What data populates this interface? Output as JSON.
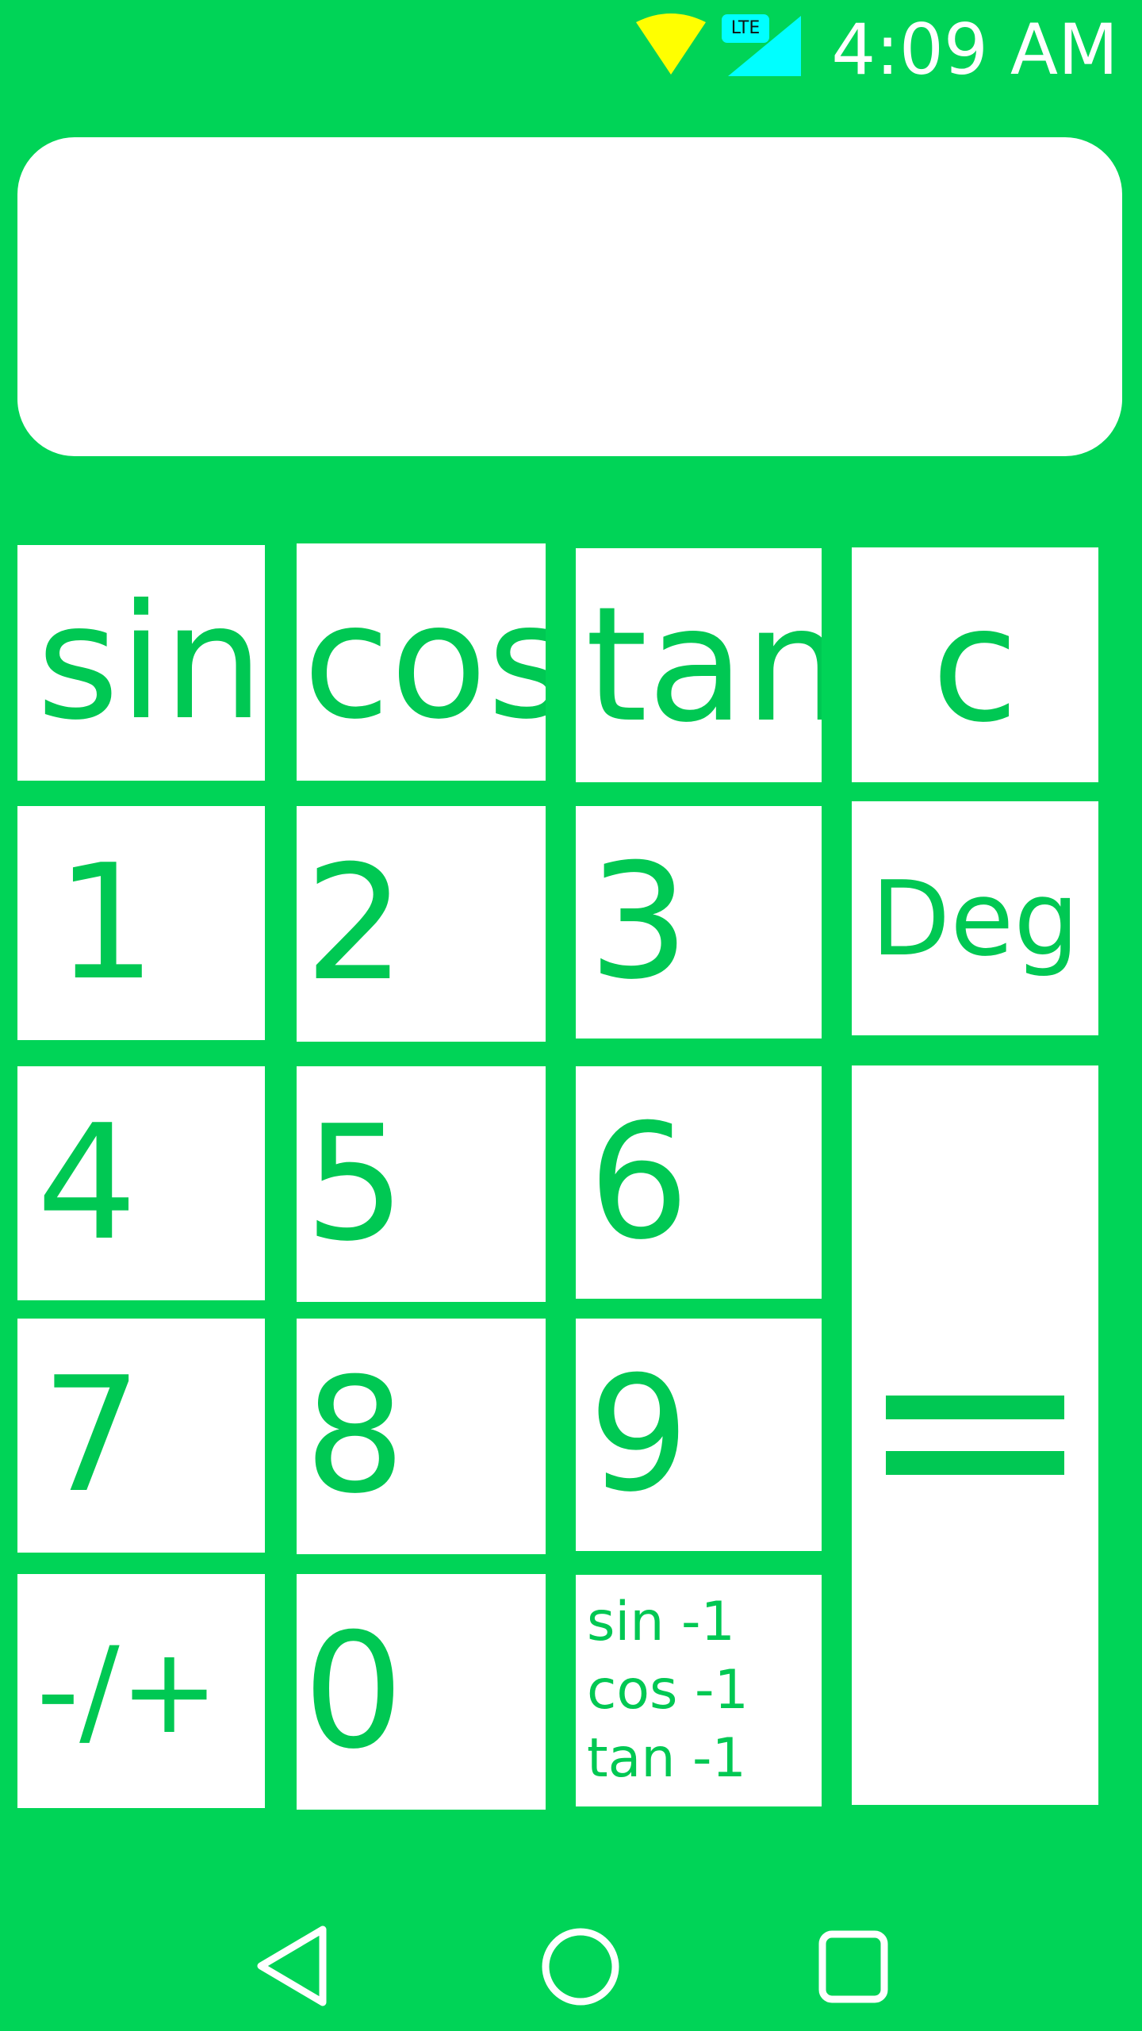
{
  "status_bar": {
    "time": "4:09 AM",
    "network_badge": "LTE",
    "wifi_color": "#FFFF00",
    "signal_color": "#00FFFF"
  },
  "display": {
    "value": ""
  },
  "keys": {
    "sin": "sin",
    "cos": "cos",
    "tan": "tan",
    "clear": "c",
    "one": "1",
    "two": "2",
    "three": "3",
    "deg": "Deg",
    "four": "4",
    "five": "5",
    "six": "6",
    "seven": "7",
    "eight": "8",
    "nine": "9",
    "sign": "-/+",
    "zero": "0",
    "inverse": [
      "sin -1",
      "cos -1",
      "tan -1"
    ],
    "equals": "="
  },
  "nav": {
    "back_icon": "back-triangle-icon",
    "home_icon": "home-circle-icon",
    "recents_icon": "recents-square-icon"
  },
  "colors": {
    "background": "#00D457",
    "key_text": "#00C853",
    "key_background": "#FFFFFF"
  }
}
